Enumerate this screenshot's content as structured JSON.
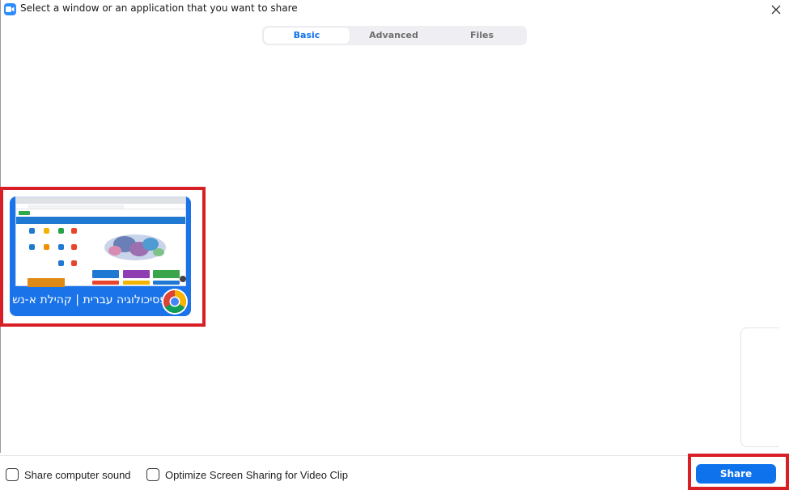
{
  "window": {
    "title": "Select a window or an application that you want to share",
    "app_icon": "zoom-camera-icon",
    "close_icon": "close-icon"
  },
  "tabs": [
    {
      "label": "Basic",
      "selected": true
    },
    {
      "label": "Advanced",
      "selected": false
    },
    {
      "label": "Files",
      "selected": false
    }
  ],
  "share_items": [
    {
      "caption": "פסיכולוגיה עברית | קהילת א-נשי ...",
      "app_icon": "chrome-icon",
      "highlighted": true
    }
  ],
  "options": {
    "share_sound_label": "Share computer sound",
    "share_sound_checked": false,
    "optimize_label": "Optimize Screen Sharing for Video Clip",
    "optimize_checked": false
  },
  "actions": {
    "share_label": "Share"
  },
  "colors": {
    "accent": "#0e72ed",
    "tile": "#1a73e8",
    "highlight": "#d81f26",
    "tab_bg": "#eeeef3"
  }
}
